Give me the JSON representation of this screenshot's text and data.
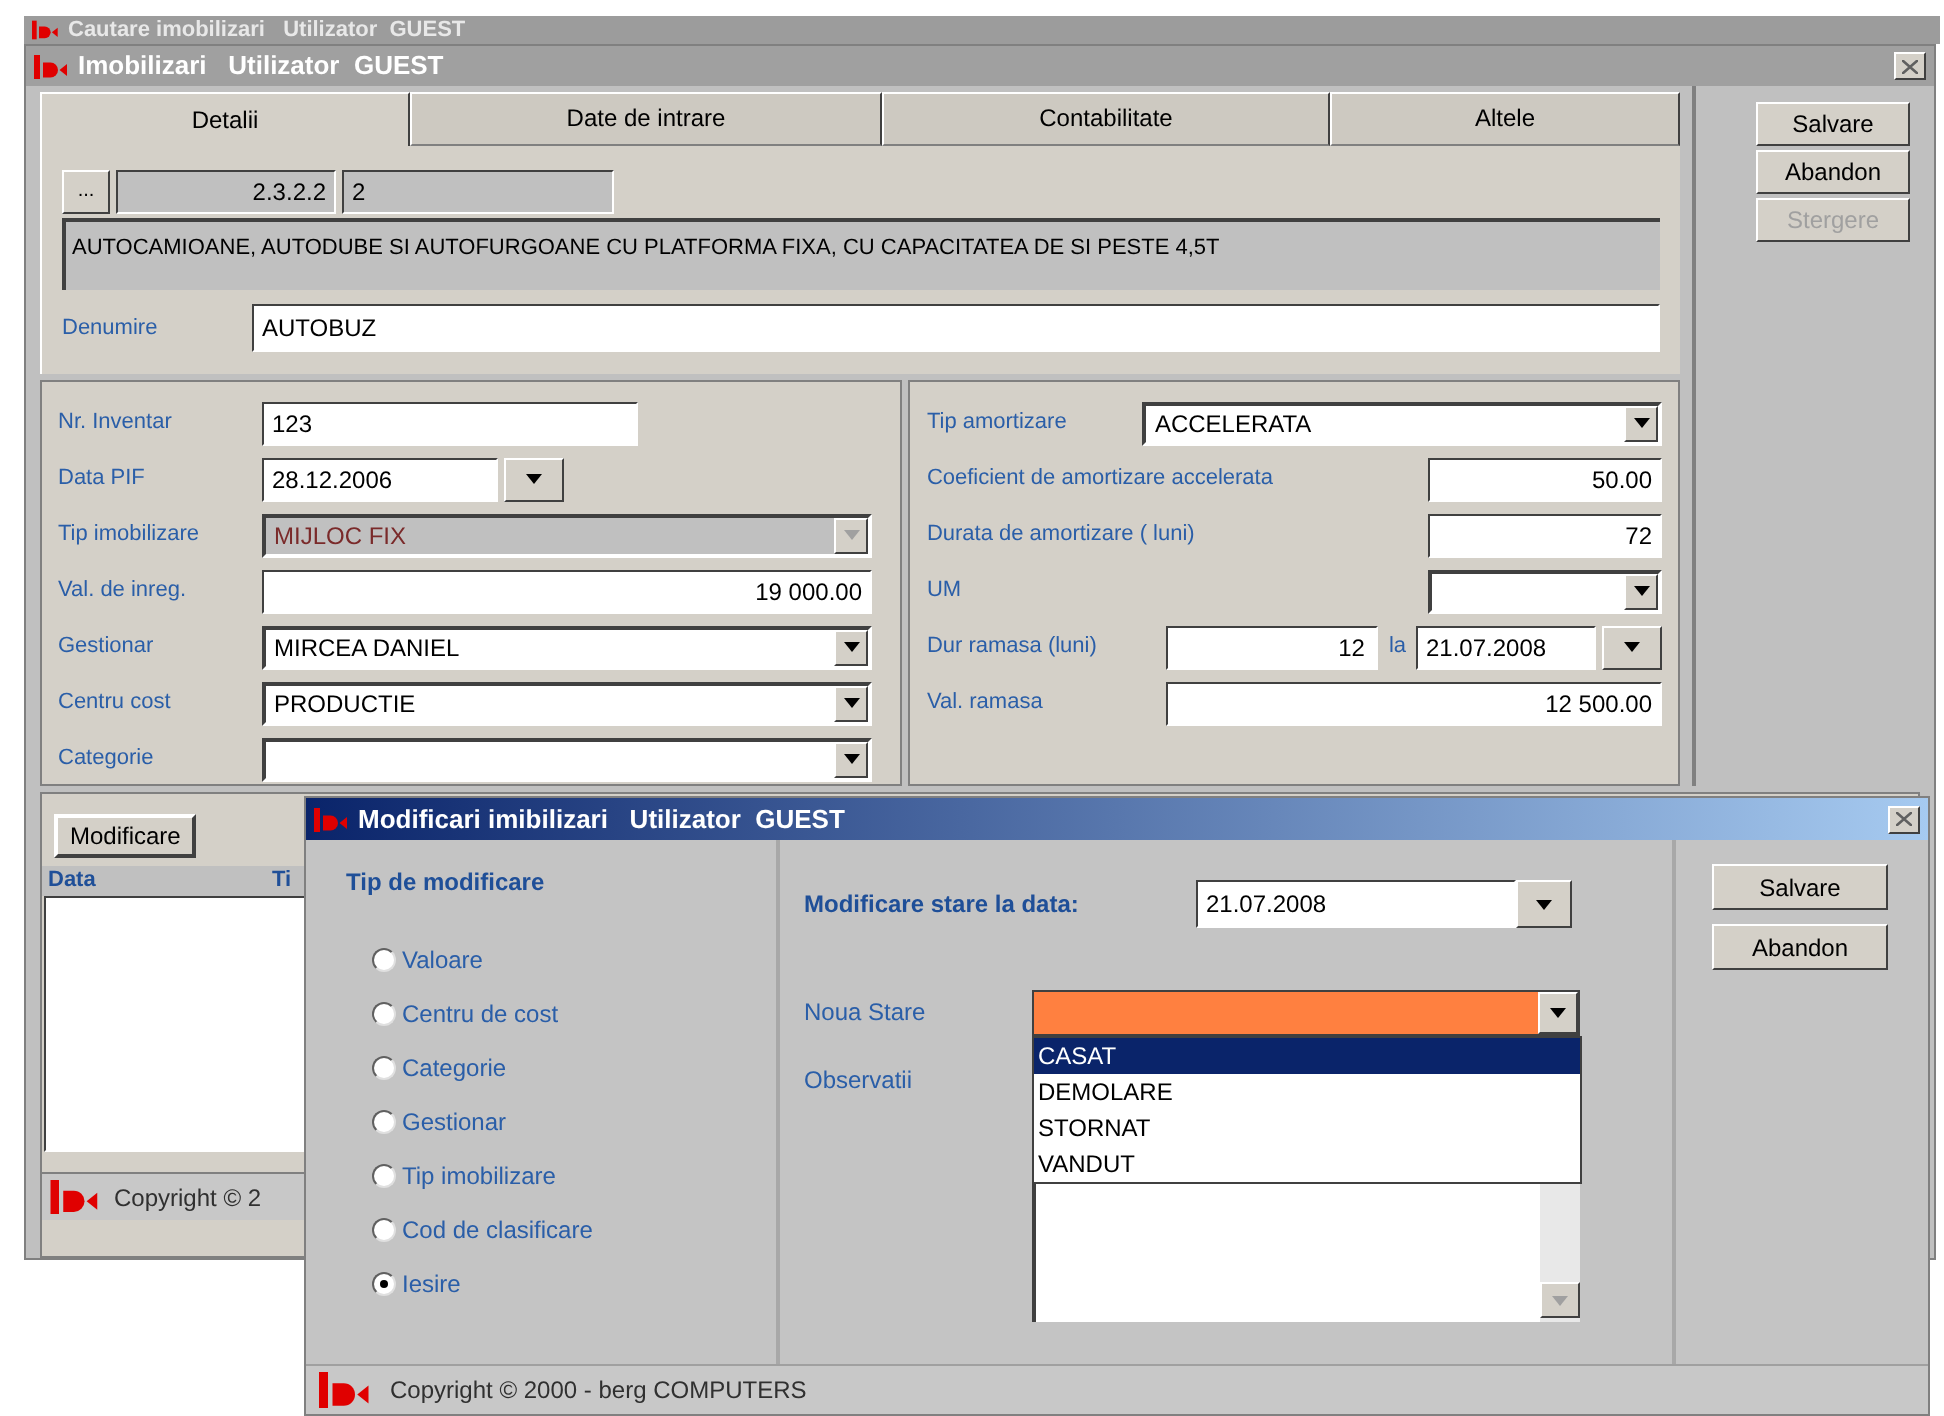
{
  "background_window": {
    "title": "Cautare imobilizari   Utilizator  GUEST"
  },
  "main_window": {
    "title": "Imobilizari   Utilizator  GUEST",
    "tabs": [
      {
        "label": "Detalii",
        "selected": true
      },
      {
        "label": "Date de intrare",
        "selected": false
      },
      {
        "label": "Contabilitate",
        "selected": false
      },
      {
        "label": "Altele",
        "selected": false
      }
    ],
    "classification": {
      "browse": "...",
      "code": "2.3.2.2",
      "sub": "2",
      "description": "AUTOCAMIOANE, AUTODUBE SI AUTOFURGOANE CU PLATFORMA FIXA, CU CAPACITATEA DE SI PESTE 4,5T"
    },
    "name_field": {
      "label": "Denumire",
      "value": "AUTOBUZ"
    },
    "left_fields": [
      {
        "kind": "text",
        "label": "Nr. Inventar",
        "value": "123",
        "disabled": false
      },
      {
        "kind": "date",
        "label": "Data PIF",
        "value": "28.12.2006",
        "disabled": false
      },
      {
        "kind": "combo",
        "label": "Tip imobilizare",
        "value": "MIJLOC FIX",
        "disabled": true
      },
      {
        "kind": "amount",
        "label": "Val. de inreg.",
        "value": "19 000.00",
        "disabled": false
      },
      {
        "kind": "combo",
        "label": "Gestionar",
        "value": "MIRCEA DANIEL",
        "disabled": false
      },
      {
        "kind": "combo",
        "label": "Centru cost",
        "value": "PRODUCTIE",
        "disabled": false
      },
      {
        "kind": "combo",
        "label": "Categorie",
        "disabled": false
      }
    ],
    "right_fields": [
      {
        "kind": "combo",
        "label": "Tip amortizare",
        "value": "ACCELERATA"
      },
      {
        "kind": "number",
        "label": "Coeficient de amortizare accelerata",
        "value": "50.00"
      },
      {
        "kind": "number",
        "label": "Durata de amortizare ( luni)",
        "value": "72"
      },
      {
        "kind": "small_combo",
        "label": "UM"
      },
      {
        "kind": "remaining",
        "label": "Dur ramasa (luni)",
        "value": "12",
        "connector": "la",
        "date": "21.07.2008"
      },
      {
        "kind": "amount",
        "label": "Val. ramasa",
        "value": "12 500.00"
      }
    ],
    "buttons": [
      {
        "label": "Salvare",
        "disabled": false
      },
      {
        "label": "Abandon",
        "disabled": false
      },
      {
        "label": "Stergere",
        "disabled": true
      }
    ],
    "history": {
      "button": "Modificare",
      "columns": [
        "Data",
        "Ti"
      ]
    },
    "status": "Copyright © 2"
  },
  "dialog": {
    "title": "Modificari imibilizari   Utilizator  GUEST",
    "group_title": "Tip de modificare",
    "options": [
      {
        "label": "Valoare",
        "selected": false
      },
      {
        "label": "Centru de cost",
        "selected": false
      },
      {
        "label": "Categorie",
        "selected": false
      },
      {
        "label": "Gestionar",
        "selected": false
      },
      {
        "label": "Tip imobilizare",
        "selected": false
      },
      {
        "label": "Cod de clasificare",
        "selected": false
      },
      {
        "label": "Iesire",
        "selected": true
      }
    ],
    "date_label": "Modificare stare la data:",
    "date_value": "21.07.2008",
    "state_label": "Noua Stare",
    "state_options": [
      {
        "label": "CASAT",
        "selected": true
      },
      {
        "label": "DEMOLARE",
        "selected": false
      },
      {
        "label": "STORNAT",
        "selected": false
      },
      {
        "label": "VANDUT",
        "selected": false
      }
    ],
    "notes_label": "Observatii",
    "buttons": [
      {
        "label": "Salvare"
      },
      {
        "label": "Abandon"
      }
    ],
    "status": "Copyright © 2000 - berg COMPUTERS"
  }
}
